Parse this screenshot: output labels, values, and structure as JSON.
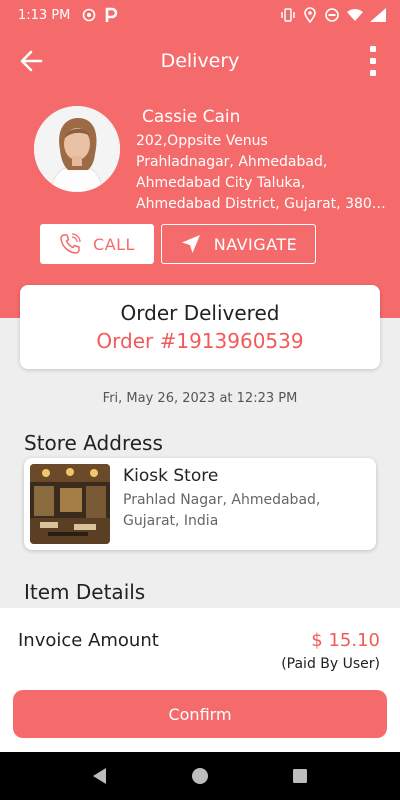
{
  "status_bar": {
    "time": "1:13 PM",
    "left_icons": [
      "settings-icon",
      "parking-icon"
    ],
    "right_icons": [
      "vibrate-icon",
      "location-icon",
      "dnd-icon",
      "wifi-icon",
      "battery-icon"
    ]
  },
  "header": {
    "title": "Delivery",
    "back_icon": "arrow-left-icon",
    "more_icon": "more-vertical-icon"
  },
  "customer": {
    "name": "Cassie Cain",
    "address_lines": [
      " 202,Oppsite Venus",
      "Prahladnagar, Ahmedabad,",
      "Ahmedabad City Taluka,",
      "Ahmedabad District, Gujarat, 3800..."
    ]
  },
  "actions": {
    "call_label": "CALL",
    "navigate_label": "NAVIGATE"
  },
  "order": {
    "status": "Order Delivered",
    "number": "Order #1913960539",
    "date": "Fri, May 26, 2023 at 12:23 PM"
  },
  "store": {
    "section_title": "Store Address",
    "name": "Kiosk Store",
    "address_lines": [
      "Prahlad Nagar, Ahmedabad,",
      "Gujarat, India"
    ]
  },
  "items": {
    "section_title": "Item Details"
  },
  "invoice": {
    "label": "Invoice Amount",
    "amount": "$ 15.10",
    "paid_by": "(Paid By User)"
  },
  "confirm_label": "Confirm",
  "colors": {
    "accent": "#f56b6b",
    "accent_text": "#f25a5a",
    "background": "#eeeeee"
  }
}
